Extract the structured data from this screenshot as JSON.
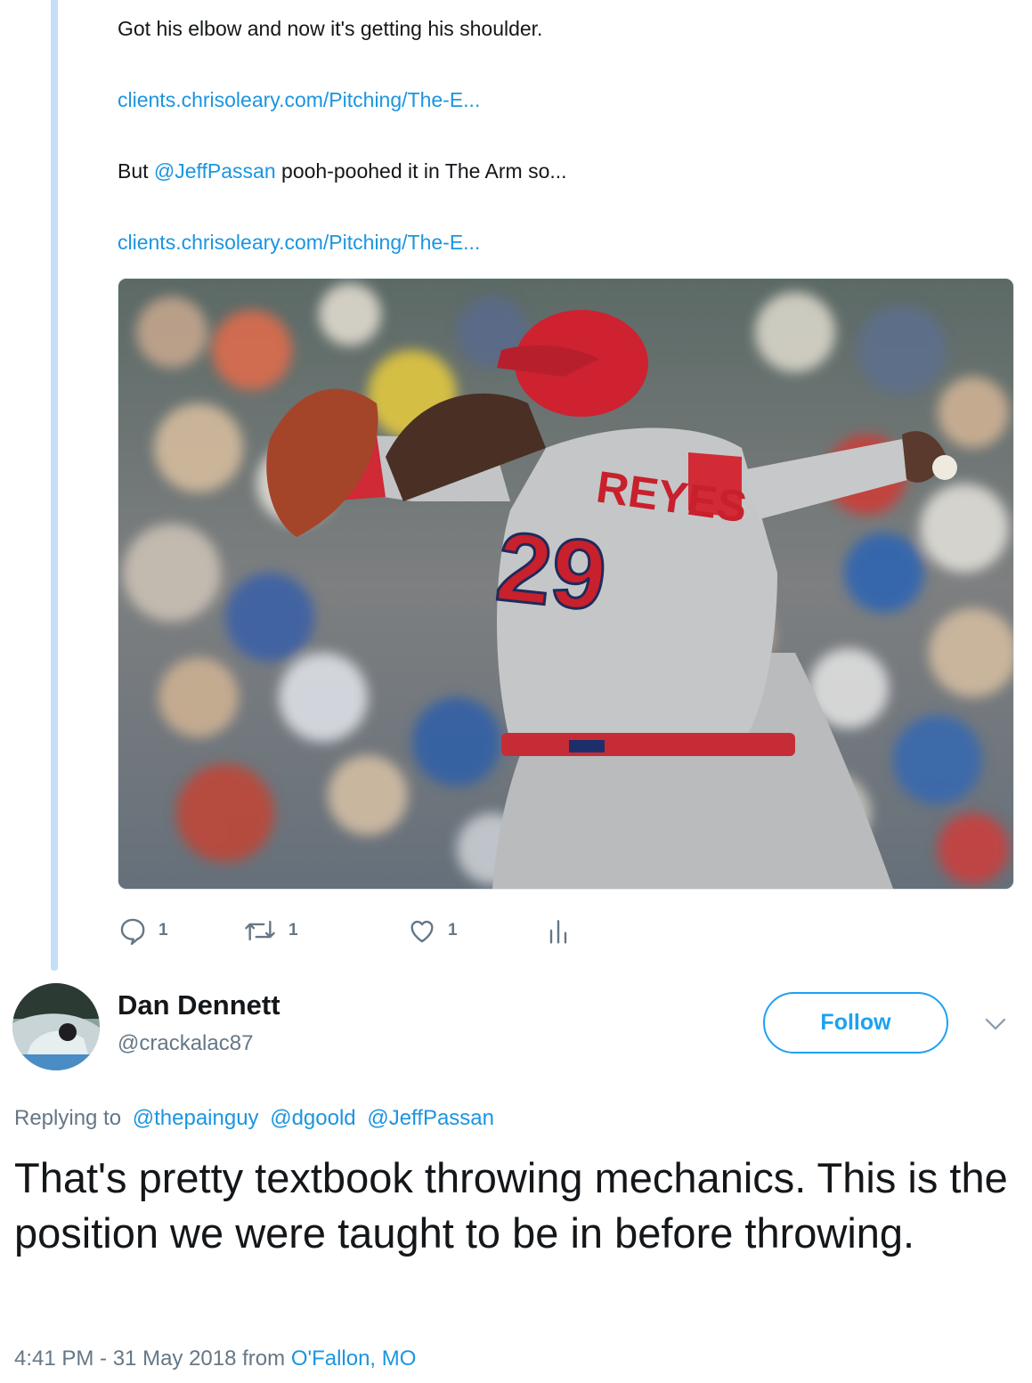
{
  "parent_tweet": {
    "line1": "Got his elbow and now it's getting his shoulder.",
    "link1": "clients.chrisoleary.com/Pitching/The-E...",
    "line3_prefix": "But ",
    "line3_mention": "@JeffPassan",
    "line3_suffix": " pooh-poohed it in The Arm so...",
    "link2": "clients.chrisoleary.com/Pitching/The-E...",
    "actions": {
      "reply_count": "1",
      "retweet_count": "1",
      "like_count": "1"
    }
  },
  "reply_tweet": {
    "display_name": "Dan Dennett",
    "handle": "@crackalac87",
    "follow_label": "Follow",
    "replying_to_label": "Replying to",
    "replying_to_mentions": [
      "@thepainguy",
      "@dgoold",
      "@JeffPassan"
    ],
    "text": "That's pretty textbook throwing mechanics. This is the position we were taught to be in before throwing.",
    "timestamp": "4:41 PM - 31 May 2018 from ",
    "location": "O'Fallon, MO"
  },
  "photo": {
    "jersey_name": "REYES",
    "jersey_number": "29"
  },
  "colors": {
    "link": "#1b95e0",
    "follow_blue": "#1da1f2",
    "secondary_text": "#657786",
    "thread_line": "#c4dff5",
    "jersey_red": "#c8202c"
  },
  "icons": [
    "reply-icon",
    "retweet-icon",
    "like-icon",
    "analytics-icon",
    "chevron-down-icon"
  ]
}
